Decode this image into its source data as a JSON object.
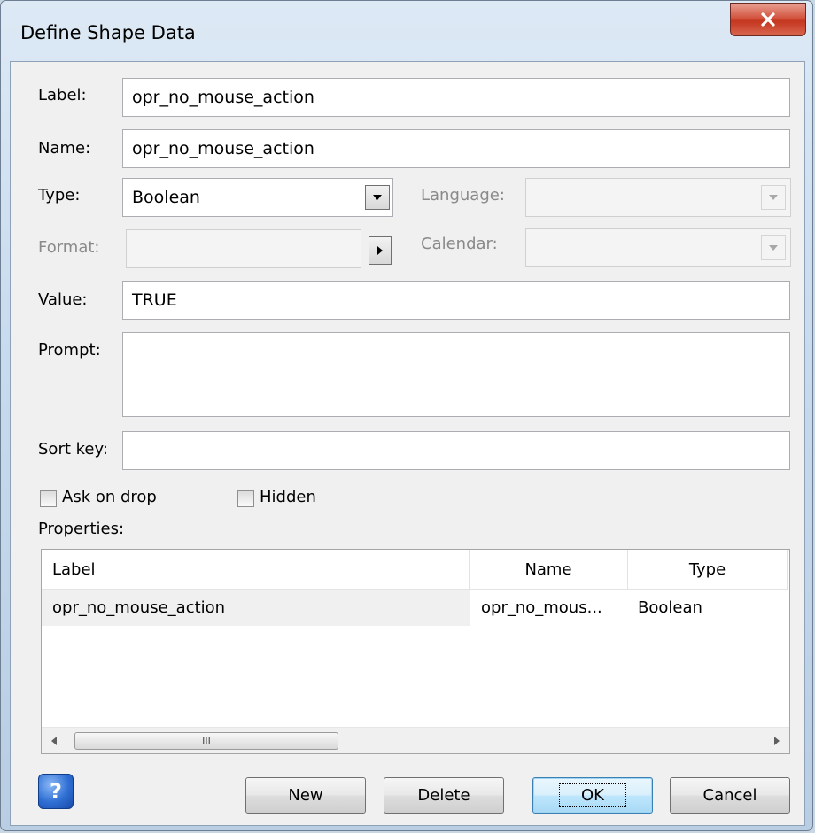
{
  "window": {
    "title": "Define Shape Data"
  },
  "form": {
    "label": {
      "label": "Label:",
      "value": "opr_no_mouse_action"
    },
    "name": {
      "label": "Name:",
      "value": "opr_no_mouse_action"
    },
    "type": {
      "label": "Type:",
      "value": "Boolean"
    },
    "language": {
      "label": "Language:",
      "value": ""
    },
    "format": {
      "label": "Format:",
      "value": ""
    },
    "calendar": {
      "label": "Calendar:",
      "value": ""
    },
    "value": {
      "label": "Value:",
      "value": "TRUE"
    },
    "prompt": {
      "label": "Prompt:",
      "value": ""
    },
    "sort_key": {
      "label": "Sort key:",
      "value": ""
    }
  },
  "checkboxes": {
    "ask_on_drop": {
      "label": "Ask on drop",
      "checked": false
    },
    "hidden": {
      "label": "Hidden",
      "checked": false
    }
  },
  "properties": {
    "title": "Properties:",
    "columns": [
      "Label",
      "Name",
      "Type"
    ],
    "rows": [
      {
        "label": "opr_no_mouse_action",
        "name": "opr_no_mous...",
        "type": "Boolean"
      }
    ],
    "scroll_thumb_grip": "III"
  },
  "buttons": {
    "help": "?",
    "new": "New",
    "delete": "Delete",
    "ok": "OK",
    "cancel": "Cancel"
  },
  "icons": {
    "close": "close-icon",
    "dropdown": "chevron-down-icon",
    "format_arrow": "triangle-right-icon"
  }
}
